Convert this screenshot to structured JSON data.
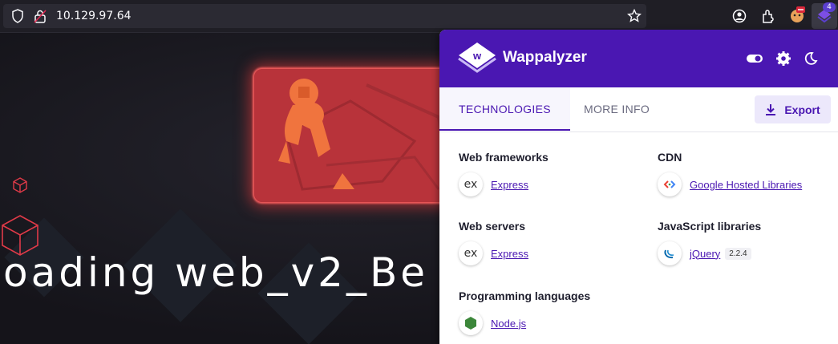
{
  "browser": {
    "url": "10.129.97.64",
    "extension_badge": "4"
  },
  "page": {
    "loading_text": "oading web_v2_Be"
  },
  "wappalyzer": {
    "brand": "Wappalyzer",
    "tabs": [
      {
        "label": "TECHNOLOGIES",
        "active": true
      },
      {
        "label": "MORE INFO",
        "active": false
      }
    ],
    "export_label": "Export",
    "categories": [
      {
        "name": "Web frameworks",
        "technologies": [
          {
            "name": "Express",
            "icon": "express-icon"
          }
        ]
      },
      {
        "name": "CDN",
        "technologies": [
          {
            "name": "Google Hosted Libraries",
            "icon": "google-hosted-libraries-icon"
          }
        ]
      },
      {
        "name": "Web servers",
        "technologies": [
          {
            "name": "Express",
            "icon": "express-icon"
          }
        ]
      },
      {
        "name": "JavaScript libraries",
        "technologies": [
          {
            "name": "jQuery",
            "version": "2.2.4",
            "icon": "jquery-icon"
          }
        ]
      },
      {
        "name": "Programming languages",
        "technologies": [
          {
            "name": "Node.js",
            "icon": "nodejs-icon"
          }
        ]
      }
    ]
  },
  "colors": {
    "wappalyzer_purple": "#4a17b2",
    "hero_red": "#b8333a"
  }
}
